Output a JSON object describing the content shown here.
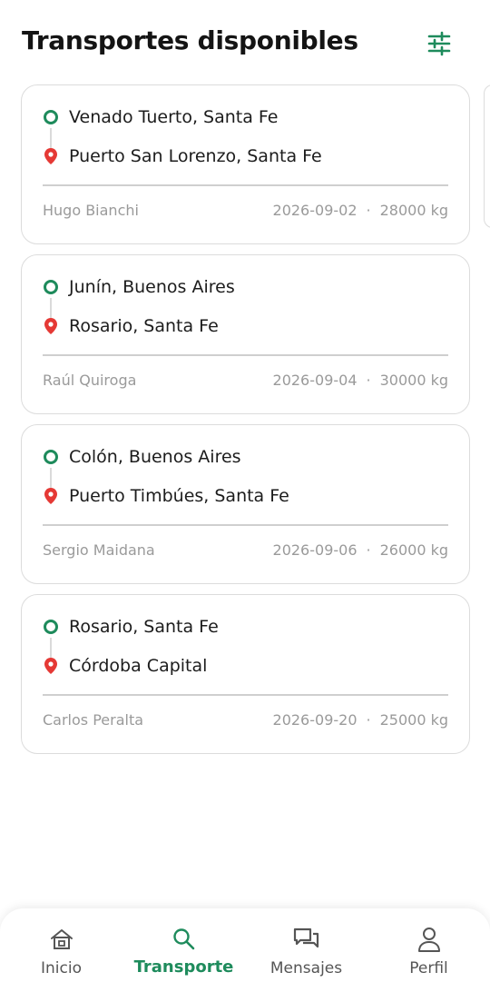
{
  "header": {
    "title": "Transportes disponibles",
    "filter_icon": "sliders-icon"
  },
  "colors": {
    "accent": "#1e8b5c",
    "pin": "#e53935",
    "muted_text": "#9a9a9a"
  },
  "transports": [
    {
      "origin": "Venado Tuerto, Santa Fe",
      "destination": "Puerto San Lorenzo, Santa Fe",
      "driver": "Hugo Bianchi",
      "date": "2026-09-02",
      "separator": "·",
      "weight": "28000 kg"
    },
    {
      "origin": "Junín, Buenos Aires",
      "destination": "Rosario, Santa Fe",
      "driver": "Raúl Quiroga",
      "date": "2026-09-04",
      "separator": "·",
      "weight": "30000 kg"
    },
    {
      "origin": "Colón, Buenos Aires",
      "destination": "Puerto Timbúes, Santa Fe",
      "driver": "Sergio Maidana",
      "date": "2026-09-06",
      "separator": "·",
      "weight": "26000 kg"
    },
    {
      "origin": "Rosario, Santa Fe",
      "destination": "Córdoba Capital",
      "driver": "Carlos Peralta",
      "date": "2026-09-20",
      "separator": "·",
      "weight": "25000 kg"
    }
  ],
  "nav": {
    "items": [
      {
        "label": "Inicio",
        "icon": "home-icon",
        "active": false
      },
      {
        "label": "Transporte",
        "icon": "search-icon",
        "active": true
      },
      {
        "label": "Mensajes",
        "icon": "chat-icon",
        "active": false
      },
      {
        "label": "Perfil",
        "icon": "user-icon",
        "active": false
      }
    ]
  }
}
